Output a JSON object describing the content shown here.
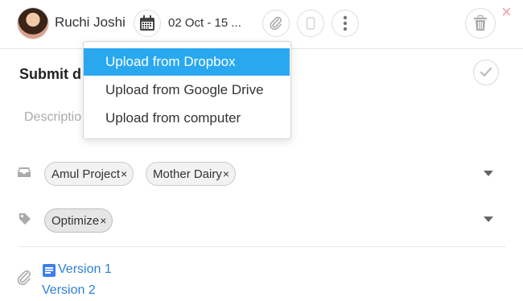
{
  "header": {
    "user_name": "Ruchi Joshi",
    "date_range": "02 Oct - 15 ...",
    "close_glyph": "×"
  },
  "task": {
    "title": "Submit d",
    "description_placeholder": "Descriptio"
  },
  "upload_menu": {
    "items": [
      "Upload from Dropbox",
      "Upload from Google Drive",
      "Upload from computer"
    ],
    "active_index": 0
  },
  "projects": {
    "chips": [
      "Amul Project",
      "Mother Dairy"
    ]
  },
  "tags": {
    "chips": [
      "Optimize"
    ]
  },
  "chip_remove_glyph": "×",
  "attachments": {
    "items": [
      "Version 1",
      "Version 2"
    ]
  },
  "colors": {
    "accent": "#29a8f0",
    "link": "#2f7fd6",
    "close": "#f0a0a8"
  }
}
